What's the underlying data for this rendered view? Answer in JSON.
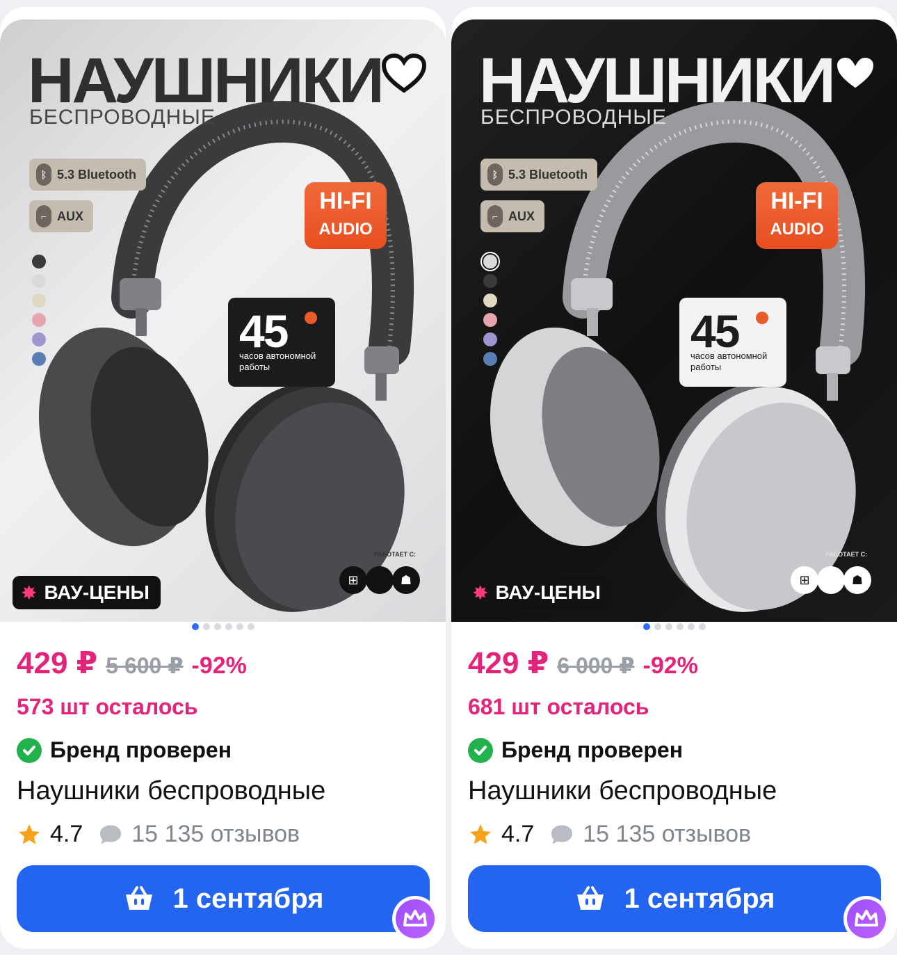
{
  "products": [
    {
      "theme": "light",
      "image": {
        "title": "НАУШНИКИ",
        "subtitle": "БЕСПРОВОДНЫЕ",
        "chip_bluetooth": "5.3 Bluetooth",
        "chip_aux": "AUX",
        "hifi_top": "HI-FI",
        "hifi_bottom": "AUDIO",
        "battery_hours": "45",
        "battery_text": "часов автономной работы",
        "works_with": "РАБОТАЕТ С:",
        "swatches": [
          "#3a3a3a",
          "#d9d9d9",
          "#e1d8c2",
          "#e8a4ae",
          "#9d96d0",
          "#5b7fb5"
        ],
        "badge": "ВАУ-ЦЕНЫ"
      },
      "carousel_dots": 6,
      "carousel_active": 0,
      "price_now": "429 ₽",
      "price_old": "5 600 ₽",
      "discount": "-92%",
      "stock": "573 шт осталось",
      "brand_status": "Бренд проверен",
      "name": "Наушники беспроводные",
      "rating": "4.7",
      "reviews": "15 135 отзывов",
      "buy_label": "1 сентября"
    },
    {
      "theme": "dark",
      "image": {
        "title": "НАУШНИКИ",
        "subtitle": "БЕСПРОВОДНЫЕ",
        "chip_bluetooth": "5.3 Bluetooth",
        "chip_aux": "AUX",
        "hifi_top": "HI-FI",
        "hifi_bottom": "AUDIO",
        "battery_hours": "45",
        "battery_text": "часов автономной работы",
        "works_with": "РАБОТАЕТ С:",
        "swatches": [
          "#d9d9d9",
          "#3a3a3a",
          "#e1d8c2",
          "#e8a4ae",
          "#9d96d0",
          "#5b7fb5"
        ],
        "badge": "ВАУ-ЦЕНЫ"
      },
      "carousel_dots": 6,
      "carousel_active": 0,
      "price_now": "429 ₽",
      "price_old": "6 000 ₽",
      "discount": "-92%",
      "stock": "681 шт осталось",
      "brand_status": "Бренд проверен",
      "name": "Наушники беспроводные",
      "rating": "4.7",
      "reviews": "15 135 отзывов",
      "buy_label": "1 сентября"
    }
  ],
  "colors": {
    "accent_pink": "#e3247a",
    "button_blue": "#2364f0",
    "verified_green": "#22b14c",
    "star_orange": "#f7a21b",
    "dot_active": "#2e6af5"
  }
}
